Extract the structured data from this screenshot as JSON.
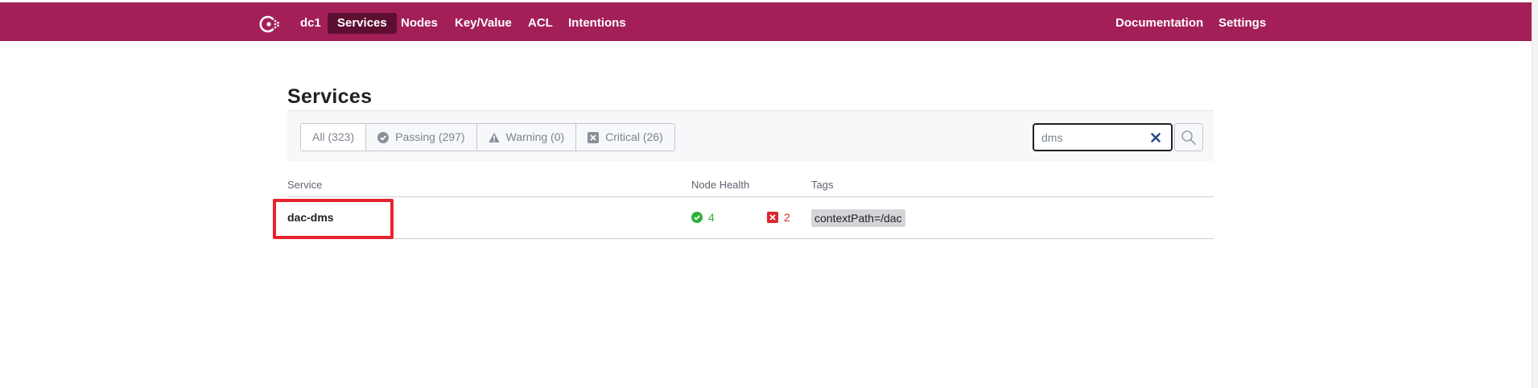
{
  "topbar": {
    "datacenter": "dc1",
    "nav": [
      "Services",
      "Nodes",
      "Key/Value",
      "ACL",
      "Intentions"
    ],
    "active": "Services",
    "right_nav": [
      "Documentation",
      "Settings"
    ],
    "brand_color": "#a21f58"
  },
  "page": {
    "title": "Services"
  },
  "filters": {
    "all": "All (323)",
    "passing": "Passing (297)",
    "warning": "Warning (0)",
    "critical": "Critical (26)",
    "active": "all"
  },
  "search": {
    "value": "dms"
  },
  "table": {
    "headers": {
      "service": "Service",
      "node_health": "Node Health",
      "tags": "Tags"
    },
    "rows": [
      {
        "name": "dac-dms",
        "passing": "4",
        "critical": "2",
        "tag": "contextPath=/dac"
      }
    ]
  },
  "colors": {
    "passing": "#2eb039",
    "critical": "#d9252e",
    "highlight": "#e8232f"
  }
}
